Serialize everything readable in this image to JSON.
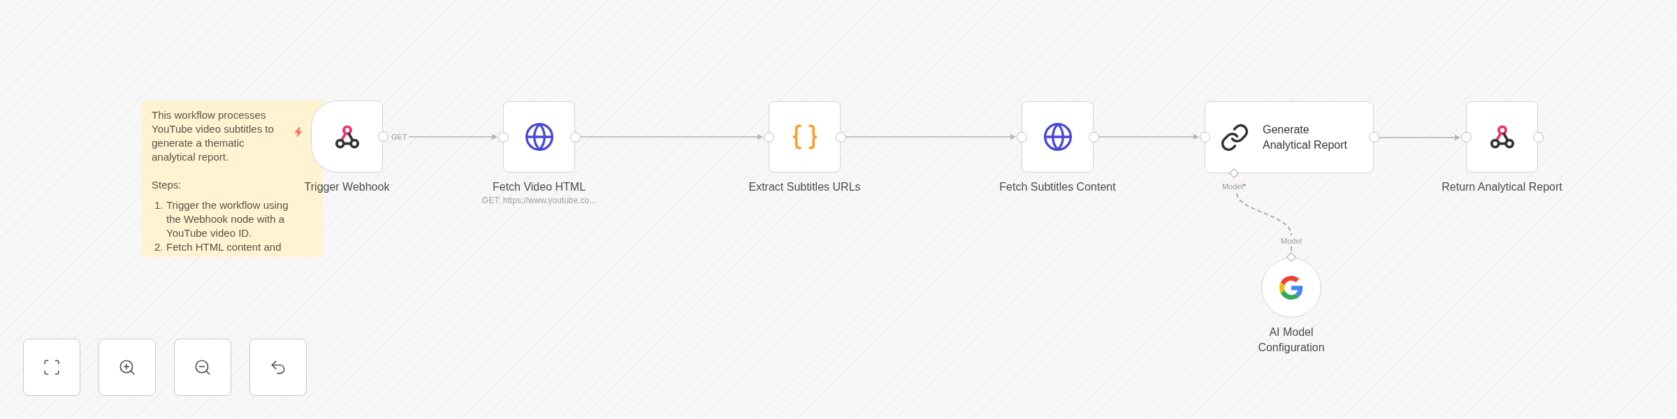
{
  "sticky_note": {
    "paragraphs": [
      "This workflow processes YouTube video subtitles to generate a thematic analytical report.",
      "Steps:"
    ],
    "steps": [
      {
        "number": "1.",
        "text": "Trigger the workflow using the Webhook node with a YouTube video ID."
      },
      {
        "number": "2.",
        "text": "Fetch HTML content and"
      }
    ]
  },
  "nodes": [
    {
      "kind": "webhook_trigger",
      "label": "Trigger Webhook",
      "output_label": "GET"
    },
    {
      "kind": "http_request",
      "label": "Fetch Video HTML",
      "subtitle": "GET: https://www.youtube.co..."
    },
    {
      "kind": "code",
      "label": "Extract Subtitles URLs"
    },
    {
      "kind": "http_request",
      "label": "Fetch Subtitles Content"
    },
    {
      "kind": "llm_chain",
      "label": "Generate Analytical Report",
      "input_port": {
        "label": "Model",
        "required_mark": "*"
      }
    },
    {
      "kind": "respond_to_webhook",
      "label": "Return Analytical Report"
    },
    {
      "kind": "language_model",
      "label": "AI Model Configuration",
      "output_port": {
        "label": "Model"
      }
    }
  ],
  "canvas_controls": [
    {
      "kind": "fit_view"
    },
    {
      "kind": "zoom_in"
    },
    {
      "kind": "zoom_out"
    },
    {
      "kind": "reset"
    }
  ]
}
